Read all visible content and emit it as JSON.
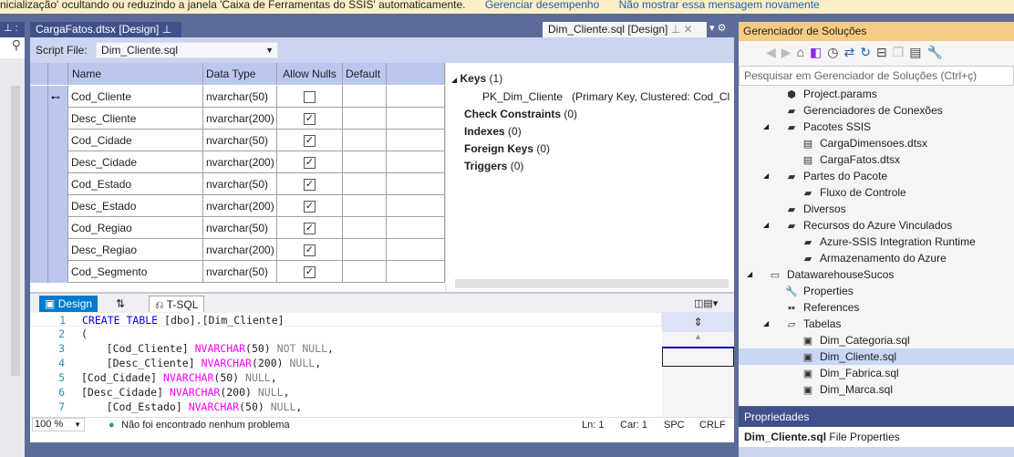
{
  "infobar": {
    "message": "nicialização' ocultando ou reduzindo a janela 'Caixa de Ferramentas do SSIS' automaticamente.",
    "link1": "Gerenciar desempenho",
    "link2": "Não mostrar essa mensagem novamente"
  },
  "tabs": [
    {
      "label": "CargaFatos.dtsx [Design]",
      "pinned": true
    },
    {
      "label": "Dim_Cliente.sql [Design]",
      "active": true
    }
  ],
  "toolbar": {
    "script_file_label": "Script File:",
    "script_file_value": "Dim_Cliente.sql"
  },
  "grid": {
    "headers": [
      "Name",
      "Data Type",
      "Allow Nulls",
      "Default"
    ],
    "rows": [
      {
        "name": "Cod_Cliente",
        "type": "nvarchar(50)",
        "nulls": false,
        "key": true
      },
      {
        "name": "Desc_Cliente",
        "type": "nvarchar(200)",
        "nulls": true
      },
      {
        "name": "Cod_Cidade",
        "type": "nvarchar(50)",
        "nulls": true
      },
      {
        "name": "Desc_Cidade",
        "type": "nvarchar(200)",
        "nulls": true
      },
      {
        "name": "Cod_Estado",
        "type": "nvarchar(50)",
        "nulls": true
      },
      {
        "name": "Desc_Estado",
        "type": "nvarchar(200)",
        "nulls": true
      },
      {
        "name": "Cod_Regiao",
        "type": "nvarchar(50)",
        "nulls": true
      },
      {
        "name": "Desc_Regiao",
        "type": "nvarchar(200)",
        "nulls": true
      },
      {
        "name": "Cod_Segmento",
        "type": "nvarchar(50)",
        "nulls": true
      }
    ]
  },
  "keys": {
    "keys_label": "Keys",
    "keys_count": "(1)",
    "pk_name": "PK_Dim_Cliente",
    "pk_desc": "(Primary Key, Clustered: Cod_Cl",
    "check": "Check Constraints",
    "check_count": "(0)",
    "indexes": "Indexes",
    "indexes_count": "(0)",
    "fk": "Foreign Keys",
    "fk_count": "(0)",
    "triggers": "Triggers",
    "triggers_count": "(0)"
  },
  "bottom_tabs": {
    "design": "Design",
    "tsql": "T-SQL"
  },
  "code": [
    {
      "n": "1",
      "t": "CREATE TABLE [dbo].[Dim_Cliente]"
    },
    {
      "n": "2",
      "t": "("
    },
    {
      "n": "3",
      "t": "    [Cod_Cliente] NVARCHAR(50) NOT NULL,"
    },
    {
      "n": "4",
      "t": "    [Desc_Cliente] NVARCHAR(200) NULL,"
    },
    {
      "n": "5",
      "t": "[Cod_Cidade] NVARCHAR(50) NULL,"
    },
    {
      "n": "6",
      "t": "[Desc_Cidade] NVARCHAR(200) NULL,"
    },
    {
      "n": "7",
      "t": "    [Cod_Estado] NVARCHAR(50) NULL,"
    }
  ],
  "status": {
    "zoom": "100 %",
    "problems": "Não foi encontrado nenhum problema",
    "ln": "Ln: 1",
    "car": "Car: 1",
    "spc": "SPC",
    "crlf": "CRLF"
  },
  "solution_explorer": {
    "title": "Gerenciador de Soluções",
    "search_placeholder": "Pesquisar em Gerenciador de Soluções (Ctrl+ç)",
    "items": [
      {
        "label": "Project.params",
        "indent": 2,
        "icon": "params-icon"
      },
      {
        "label": "Gerenciadores de Conexões",
        "indent": 2,
        "icon": "folder-icon"
      },
      {
        "label": "Pacotes SSIS",
        "indent": 2,
        "icon": "folder-icon",
        "expanded": true
      },
      {
        "label": "CargaDimensoes.dtsx",
        "indent": 3,
        "icon": "package-icon"
      },
      {
        "label": "CargaFatos.dtsx",
        "indent": 3,
        "icon": "package-icon"
      },
      {
        "label": "Partes do Pacote",
        "indent": 2,
        "icon": "folder-icon",
        "expanded": true
      },
      {
        "label": "Fluxo de Controle",
        "indent": 3,
        "icon": "folder-icon"
      },
      {
        "label": "Diversos",
        "indent": 2,
        "icon": "folder-icon"
      },
      {
        "label": "Recursos do Azure Vinculados",
        "indent": 2,
        "icon": "folder-icon",
        "expanded": true
      },
      {
        "label": "Azure-SSIS Integration Runtime",
        "indent": 3,
        "icon": "folder-icon"
      },
      {
        "label": "Armazenamento do Azure",
        "indent": 3,
        "icon": "folder-icon"
      },
      {
        "label": "DatawarehouseSucos",
        "indent": 1,
        "icon": "db-project-icon",
        "expanded": true
      },
      {
        "label": "Properties",
        "indent": 2,
        "icon": "wrench-icon"
      },
      {
        "label": "References",
        "indent": 2,
        "icon": "references-icon"
      },
      {
        "label": "Tabelas",
        "indent": 2,
        "icon": "folder-open-icon",
        "expanded": true
      },
      {
        "label": "Dim_Categoria.sql",
        "indent": 3,
        "icon": "table-icon"
      },
      {
        "label": "Dim_Cliente.sql",
        "indent": 3,
        "icon": "table-icon",
        "selected": true
      },
      {
        "label": "Dim_Fabrica.sql",
        "indent": 3,
        "icon": "table-icon"
      },
      {
        "label": "Dim_Marca.sql",
        "indent": 3,
        "icon": "table-icon"
      }
    ]
  },
  "properties": {
    "title": "Propriedades",
    "object": "Dim_Cliente.sql",
    "type": "File Properties"
  }
}
